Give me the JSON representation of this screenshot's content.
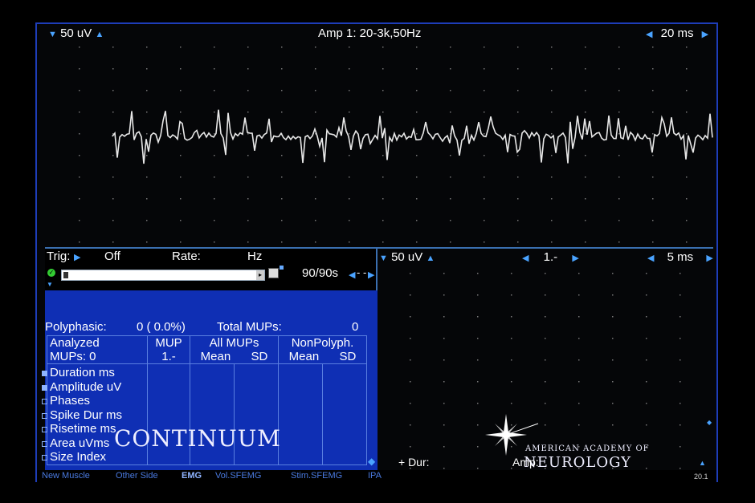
{
  "top_trace": {
    "gain": "50 uV",
    "amp": "Amp 1: 20-3k,50Hz",
    "sweep": "20 ms"
  },
  "trigger": {
    "trig_label": "Trig:",
    "trig_value": "Off",
    "rate_label": "Rate:",
    "rate_unit": "Hz",
    "counter": "90/90s",
    "counter_suffix": "- -"
  },
  "bottom_trace": {
    "gain": "50 uV",
    "index": "1.-",
    "sweep": "5 ms",
    "dur_label": "+ Dur:",
    "amp_label": "Amp:"
  },
  "stats": {
    "polyphasic_label": "Polyphasic:",
    "polyphasic_value": "0 ( 0.0%)",
    "total_label": "Total MUPs:",
    "total_value": "0",
    "analyzed_line1": "Analyzed",
    "analyzed_line2": "MUPs:  0",
    "mup_header": "MUP",
    "mup_value": "1.-",
    "all_mups_header": "All MUPs",
    "nonpoly_header": "NonPolyph.",
    "mean": "Mean",
    "sd": "SD",
    "rows": [
      {
        "label": "Duration ms",
        "checked": true
      },
      {
        "label": "Amplitude uV",
        "checked": true
      },
      {
        "label": "Phases",
        "checked": false
      },
      {
        "label": "Spike Dur ms",
        "checked": false
      },
      {
        "label": "Risetime ms",
        "checked": false
      },
      {
        "label": "Area uVms",
        "checked": false
      },
      {
        "label": "Size Index",
        "checked": false
      }
    ]
  },
  "status_bar": {
    "items": [
      "New Muscle",
      "Other Side",
      "EMG",
      "Vol.SFEMG",
      "Stim.SFEMG",
      "IPA"
    ],
    "version": "20.1"
  },
  "watermarks": {
    "continuum": "CONTINUUM",
    "aan_line1": "AMERICAN ACADEMY OF",
    "aan_line2": "NEUROLOGY"
  },
  "colors": {
    "panel_blue": "#0f2fb4",
    "trace": "#e8e8e8",
    "accent": "#4aa3ff"
  }
}
